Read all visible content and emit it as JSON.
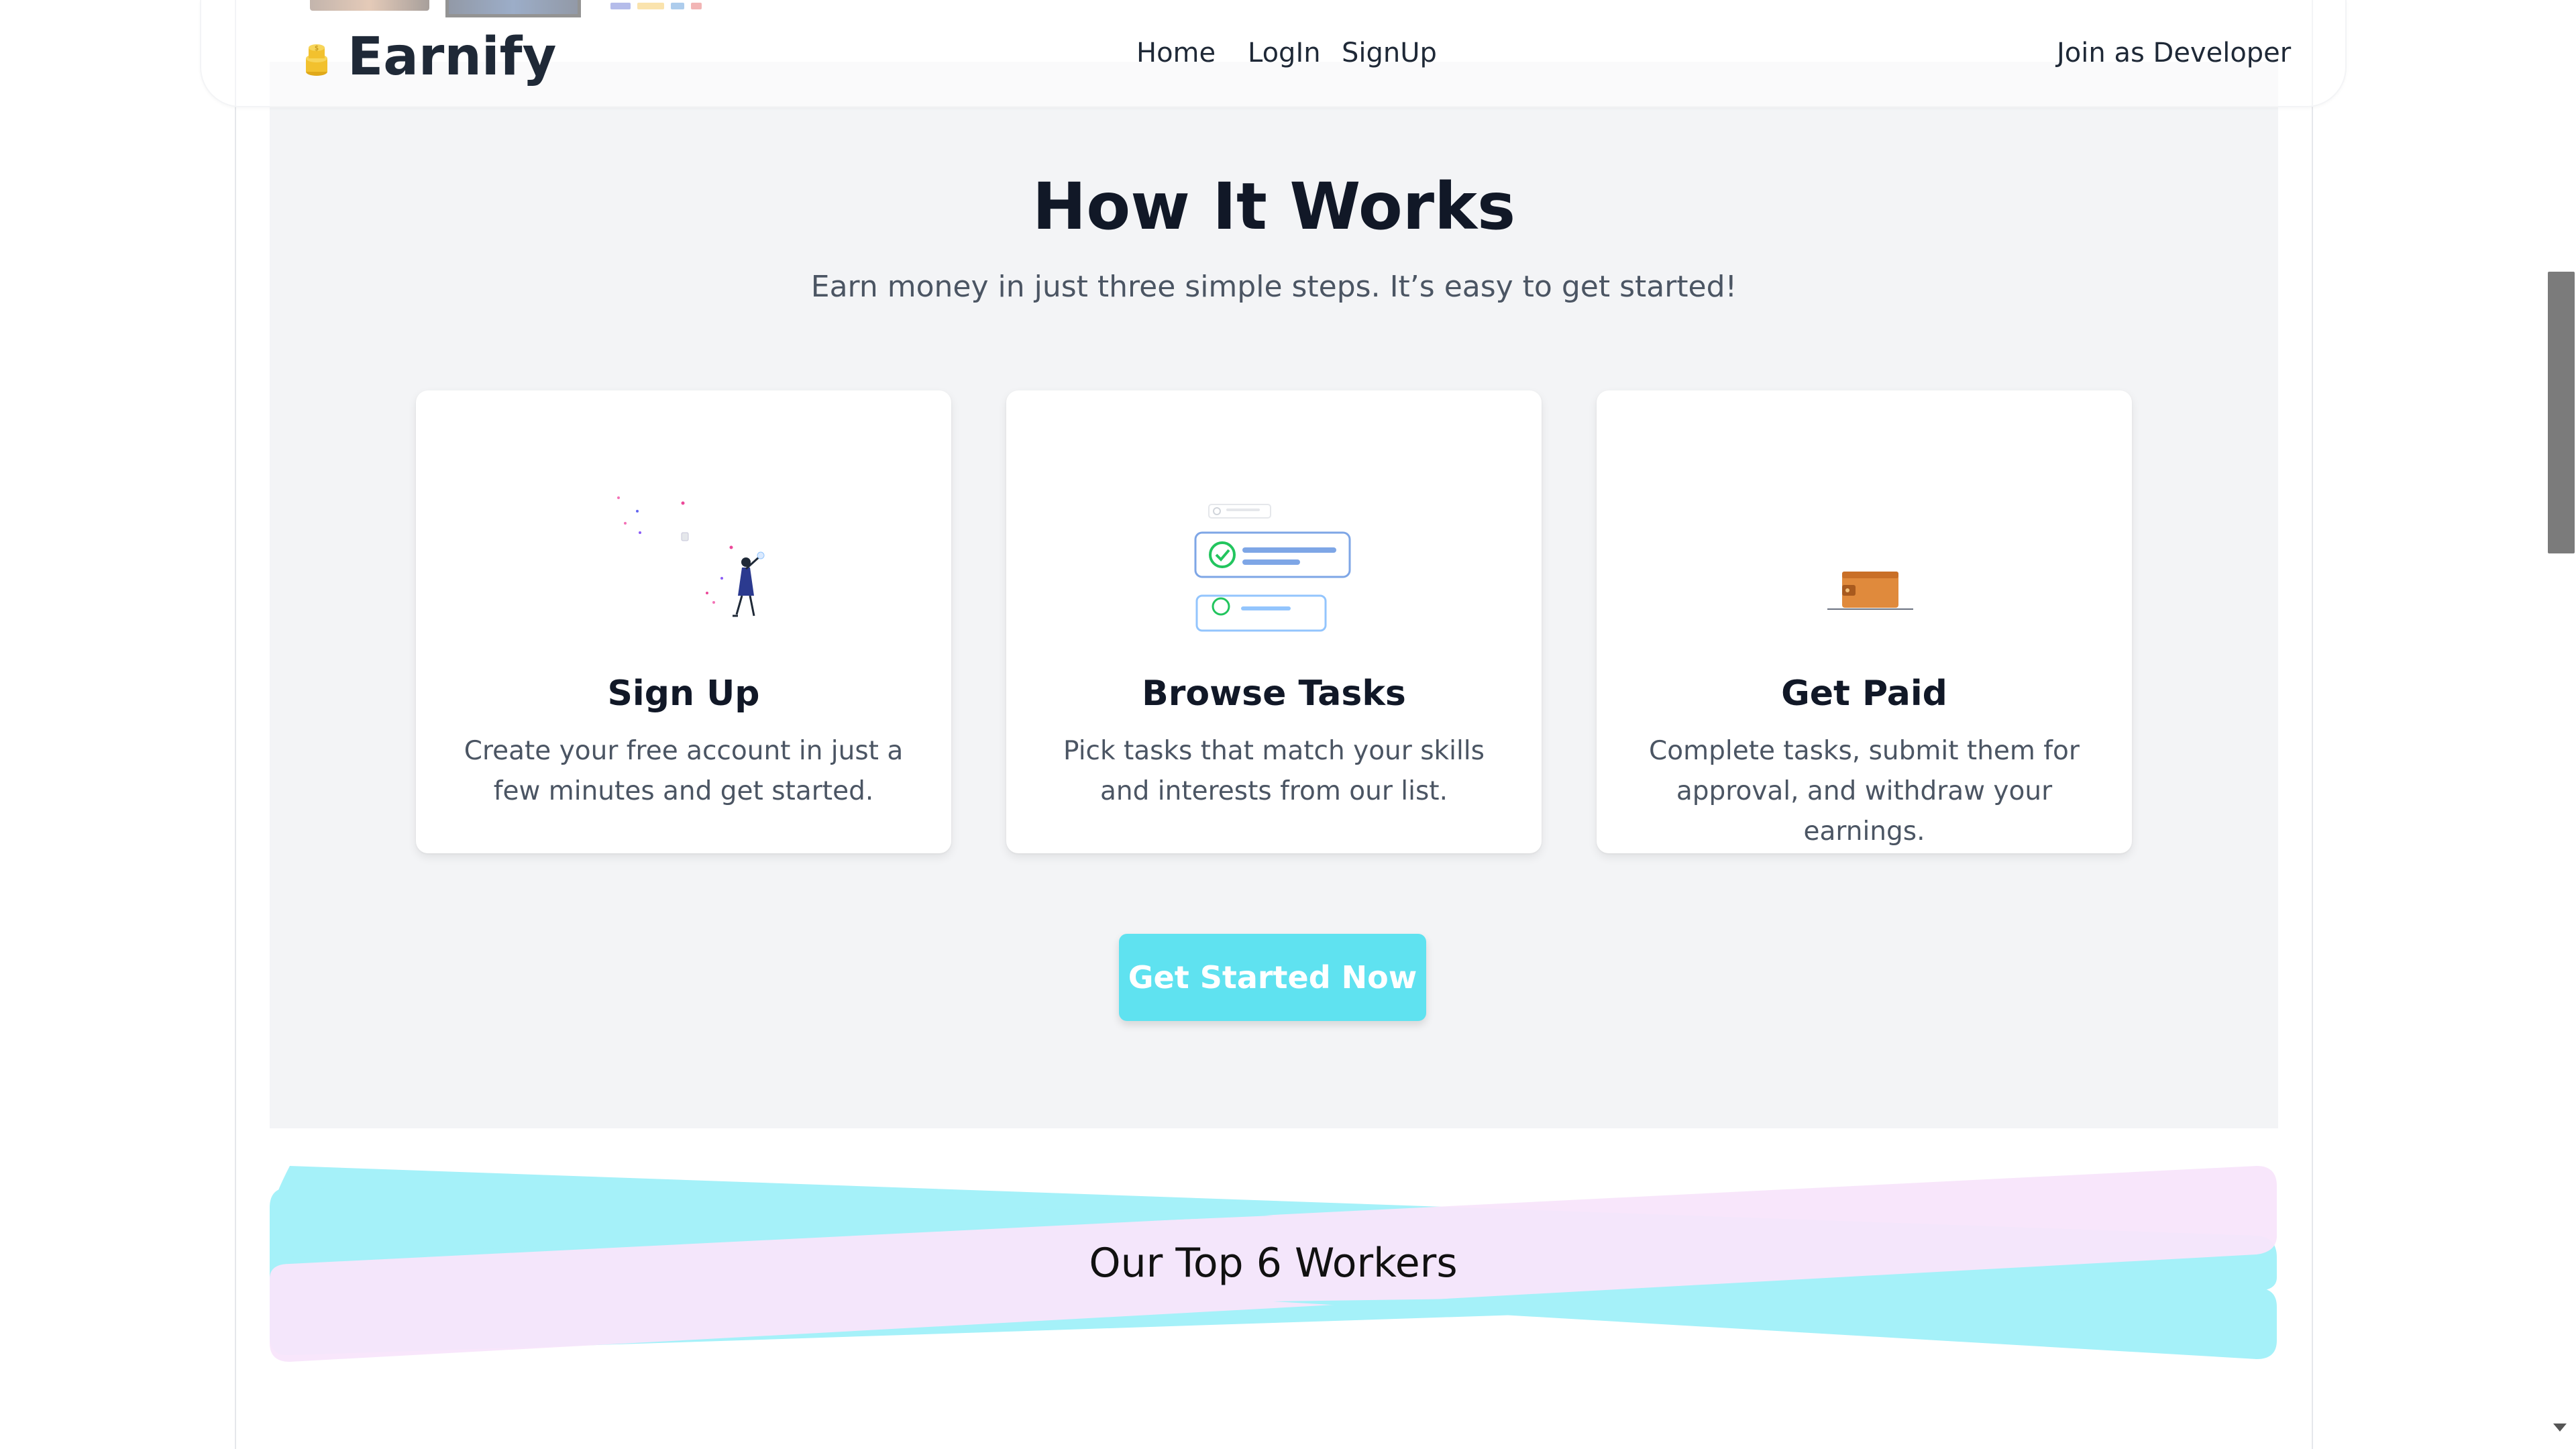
{
  "navbar": {
    "brand": "Earnify",
    "links": {
      "home": "Home",
      "login": "LogIn",
      "signup": "SignUp"
    },
    "developer": "Join as Developer"
  },
  "how_it_works": {
    "title": "How It Works",
    "subtitle": "Earn money in just three simple steps. It’s easy to get started!",
    "steps": [
      {
        "title": "Sign Up",
        "description": "Create your free account in just a few minutes and get started.",
        "icon": "woman-celebrating-illustration"
      },
      {
        "title": "Browse Tasks",
        "description": "Pick tasks that match your skills and interests from our list.",
        "icon": "checklist-illustration"
      },
      {
        "title": "Get Paid",
        "description": "Complete tasks, submit them for approval, and withdraw your earnings.",
        "icon": "wallet-illustration"
      }
    ],
    "cta": "Get Started Now"
  },
  "top_workers": {
    "title": "Our Top 6 Workers"
  },
  "colors": {
    "accent": "#5fe2f0",
    "section_bg": "#f3f4f6",
    "ribbon_cyan": "#a5f1f9",
    "ribbon_pink": "#f8e5fb"
  }
}
